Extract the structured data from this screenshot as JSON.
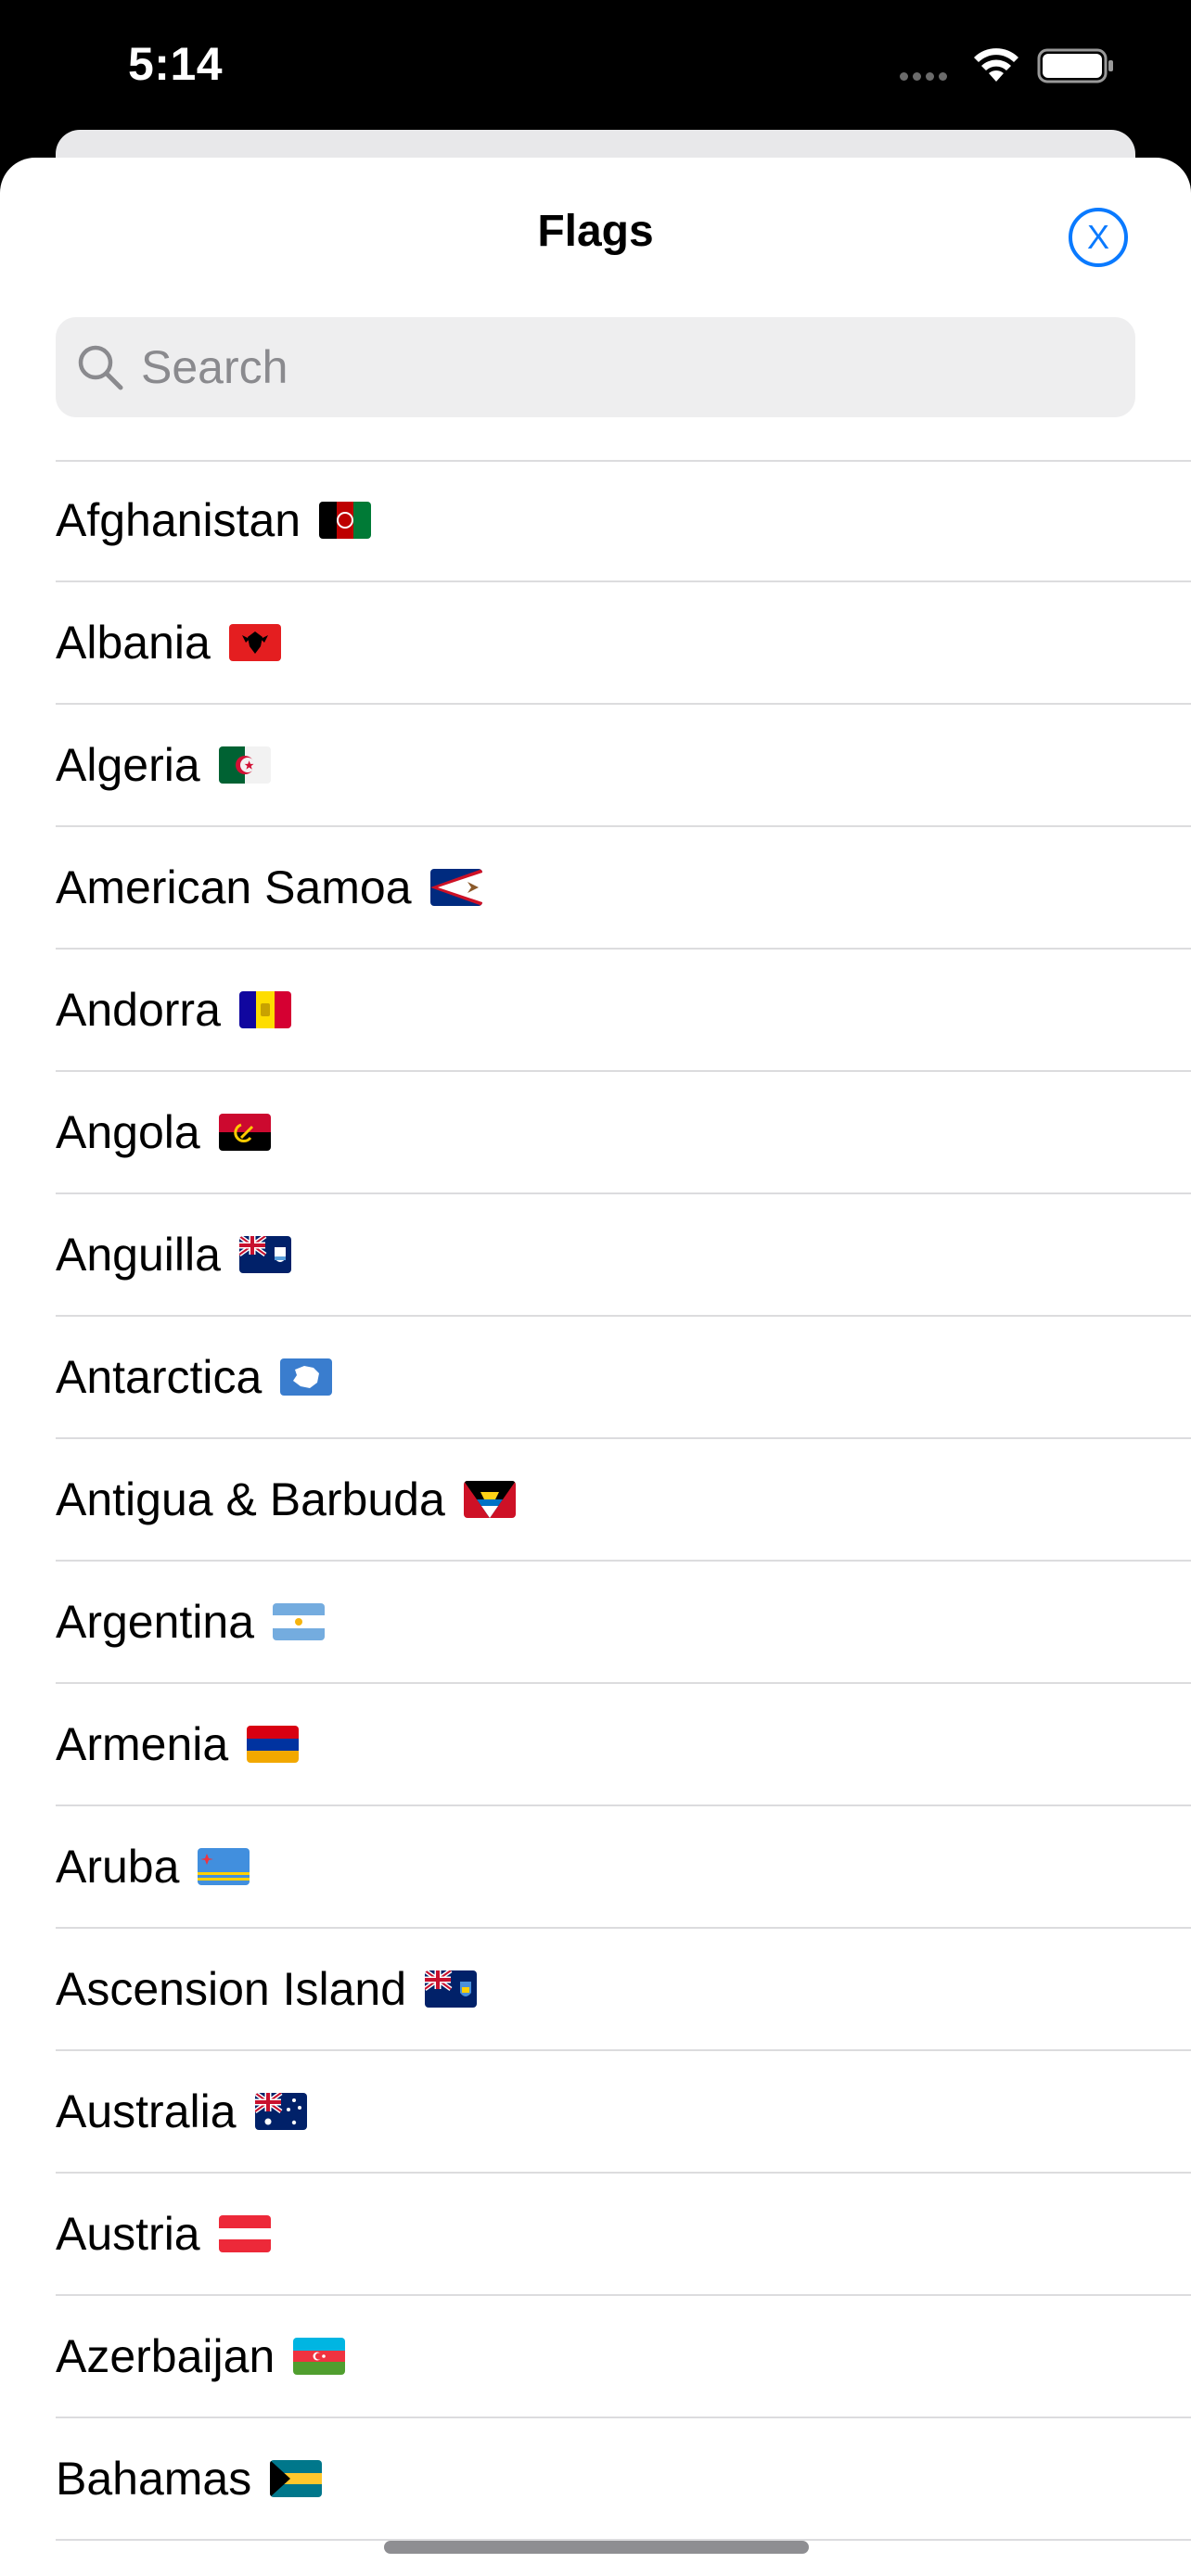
{
  "status_bar": {
    "time": "5:14"
  },
  "sheet": {
    "title": "Flags",
    "close_label": "X"
  },
  "search": {
    "placeholder": "Search",
    "value": ""
  },
  "countries": [
    {
      "name": "Afghanistan",
      "flag_icon": "afghanistan-flag-icon"
    },
    {
      "name": "Albania",
      "flag_icon": "albania-flag-icon"
    },
    {
      "name": "Algeria",
      "flag_icon": "algeria-flag-icon"
    },
    {
      "name": "American Samoa",
      "flag_icon": "american-samoa-flag-icon"
    },
    {
      "name": "Andorra",
      "flag_icon": "andorra-flag-icon"
    },
    {
      "name": "Angola",
      "flag_icon": "angola-flag-icon"
    },
    {
      "name": "Anguilla",
      "flag_icon": "anguilla-flag-icon"
    },
    {
      "name": "Antarctica",
      "flag_icon": "antarctica-flag-icon"
    },
    {
      "name": "Antigua & Barbuda",
      "flag_icon": "antigua-barbuda-flag-icon"
    },
    {
      "name": "Argentina",
      "flag_icon": "argentina-flag-icon"
    },
    {
      "name": "Armenia",
      "flag_icon": "armenia-flag-icon"
    },
    {
      "name": "Aruba",
      "flag_icon": "aruba-flag-icon"
    },
    {
      "name": "Ascension Island",
      "flag_icon": "ascension-island-flag-icon"
    },
    {
      "name": "Australia",
      "flag_icon": "australia-flag-icon"
    },
    {
      "name": "Austria",
      "flag_icon": "austria-flag-icon"
    },
    {
      "name": "Azerbaijan",
      "flag_icon": "azerbaijan-flag-icon"
    },
    {
      "name": "Bahamas",
      "flag_icon": "bahamas-flag-icon"
    }
  ],
  "colors": {
    "accent": "#0a7aff",
    "separator": "#dcdcde",
    "search_background": "#eeeeef",
    "placeholder": "#8a8a8e"
  }
}
